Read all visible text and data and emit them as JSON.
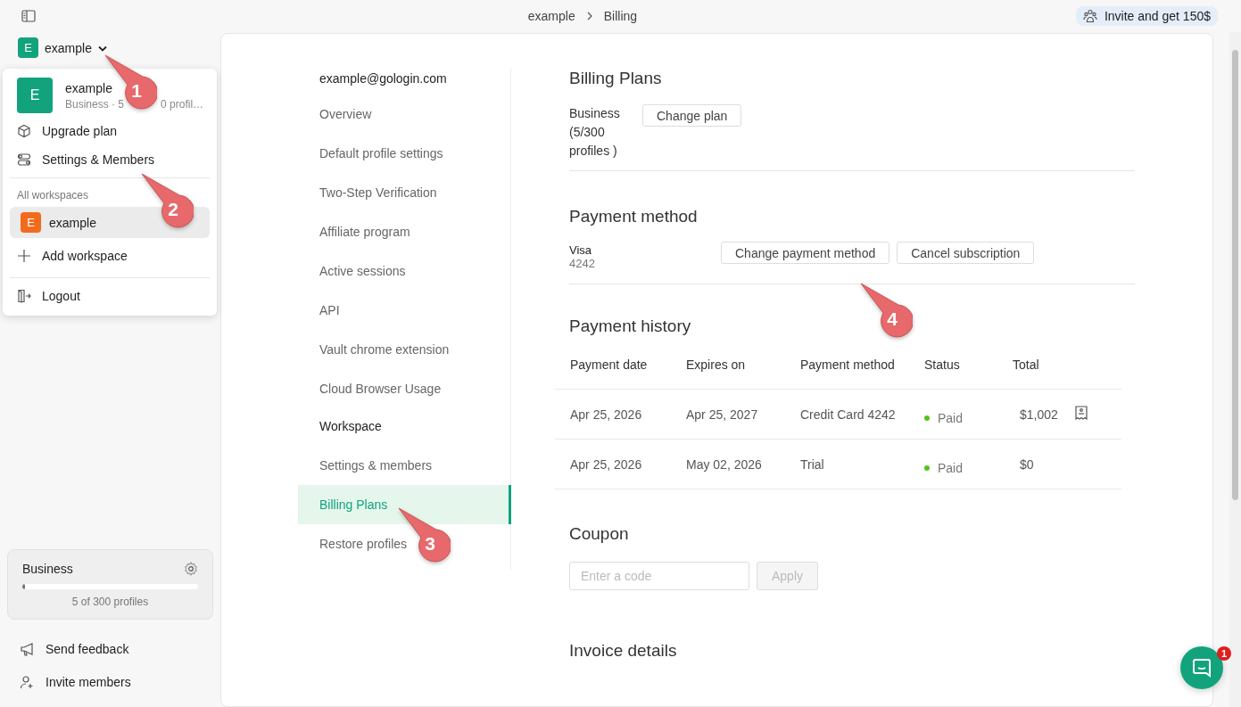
{
  "breadcrumb": [
    "example",
    "Billing"
  ],
  "invite_banner": {
    "label": "Invite and get 150$"
  },
  "workspace_switcher": {
    "initial": "E",
    "name": "example",
    "expanded": true
  },
  "workspace_menu": {
    "current": {
      "initial": "E",
      "name": "example",
      "subtitle_parts": [
        "Business · 5",
        "0 profil…"
      ]
    },
    "actions": [
      {
        "kind": "upgrade",
        "label": "Upgrade plan"
      },
      {
        "kind": "settings",
        "label": "Settings & Members"
      }
    ],
    "section_label": "All workspaces",
    "workspaces": [
      {
        "initial": "E",
        "name": "example",
        "color": "#f26b1d",
        "selected": true
      }
    ],
    "add_label": "Add workspace",
    "logout_label": "Logout"
  },
  "plan_card": {
    "name": "Business",
    "level": 0.017,
    "caption": "5 of 300 profiles"
  },
  "sidebar_footer": [
    {
      "kind": "feedback",
      "label": "Send feedback"
    },
    {
      "kind": "invite",
      "label": "Invite members"
    }
  ],
  "settings_nav": {
    "email": "example@gologin.com",
    "account_items": [
      {
        "label": "Overview",
        "selected": false
      },
      {
        "label": "Default profile settings",
        "selected": false
      },
      {
        "label": "Two-Step Verification",
        "selected": false
      },
      {
        "label": "Affiliate program",
        "selected": false
      },
      {
        "label": "Active sessions",
        "selected": false
      },
      {
        "label": "API",
        "selected": false
      },
      {
        "label": "Vault chrome extension",
        "selected": false
      },
      {
        "label": "Cloud Browser Usage",
        "selected": false
      }
    ],
    "workspace_heading": "Workspace",
    "workspace_items": [
      {
        "label": "Settings & members",
        "selected": false
      },
      {
        "label": "Billing Plans",
        "selected": true
      },
      {
        "label": "Restore profiles",
        "selected": false
      }
    ]
  },
  "billing_plans": {
    "title": "Billing Plans",
    "plan": "Business (5/300 profiles )",
    "button": "Change plan"
  },
  "payment_method": {
    "title": "Payment method",
    "card_brand": "Visa",
    "card_last4": "4242",
    "buttons": [
      "Change payment method",
      "Cancel subscription"
    ]
  },
  "payment_history": {
    "title": "Payment history",
    "columns": [
      "Payment date",
      "Expires on",
      "Payment method",
      "Status",
      "Total"
    ],
    "rows": [
      {
        "payment_date": "Apr 25, 2026",
        "expires_on": "Apr 25, 2027",
        "method": "Credit Card 4242",
        "status": "Paid",
        "total": "$1,002",
        "receipt": true
      },
      {
        "payment_date": "Apr 25, 2026",
        "expires_on": "May 02, 2026",
        "method": "Trial",
        "status": "Paid",
        "total": "$0",
        "receipt": false
      }
    ]
  },
  "coupon": {
    "title": "Coupon",
    "placeholder": "Enter a code",
    "button": "Apply",
    "button_disabled": true
  },
  "invoice_details": {
    "title": "Invoice details"
  },
  "chat": {
    "badge": "1"
  },
  "callouts": [
    {
      "number": "1"
    },
    {
      "number": "2"
    },
    {
      "number": "3"
    },
    {
      "number": "4"
    }
  ]
}
